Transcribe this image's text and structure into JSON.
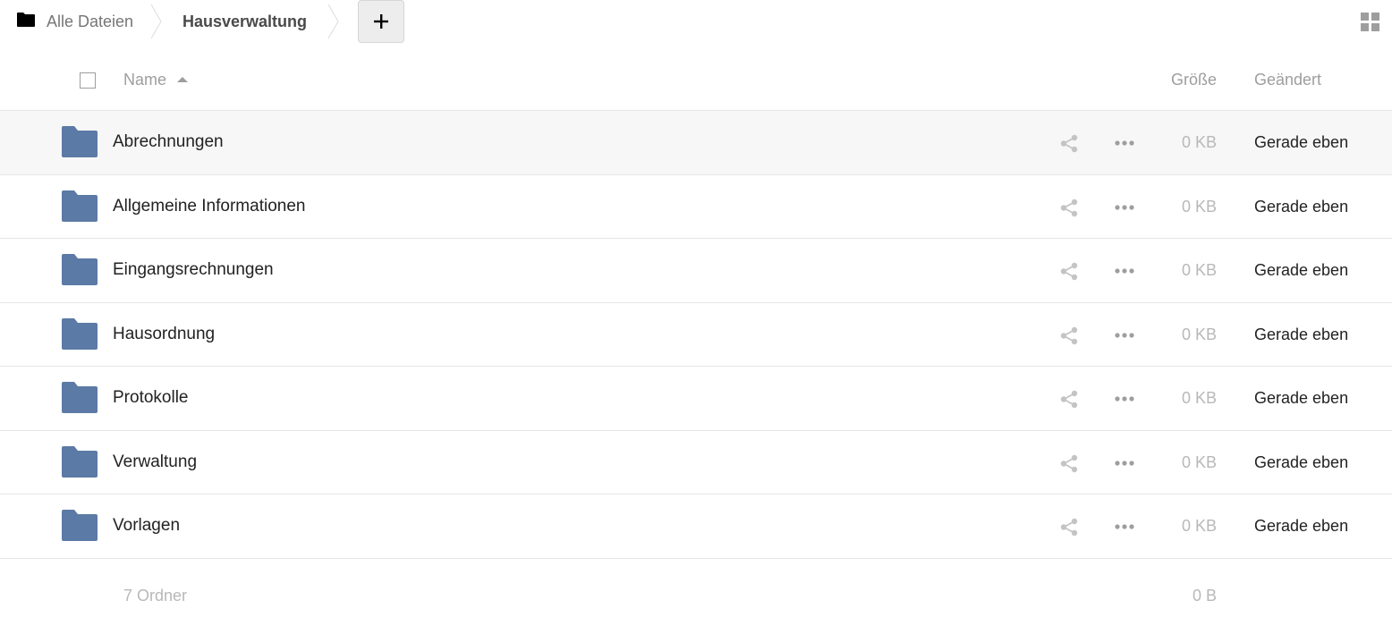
{
  "breadcrumb": {
    "home_label": "Alle Dateien",
    "current_label": "Hausverwaltung",
    "add_label": "+"
  },
  "header": {
    "name_label": "Name",
    "size_label": "Größe",
    "modified_label": "Geändert"
  },
  "colors": {
    "folder": "#5b7aa6",
    "muted_text": "#9e9e9e",
    "row_hover": "#f7f7f7",
    "border": "#e6e6e6"
  },
  "files": [
    {
      "name": "Abrechnungen",
      "size": "0 KB",
      "modified": "Gerade eben",
      "icon": "folder-icon"
    },
    {
      "name": "Allgemeine Informationen",
      "size": "0 KB",
      "modified": "Gerade eben",
      "icon": "folder-icon"
    },
    {
      "name": "Eingangsrechnungen",
      "size": "0 KB",
      "modified": "Gerade eben",
      "icon": "folder-icon"
    },
    {
      "name": "Hausordnung",
      "size": "0 KB",
      "modified": "Gerade eben",
      "icon": "folder-icon"
    },
    {
      "name": "Protokolle",
      "size": "0 KB",
      "modified": "Gerade eben",
      "icon": "folder-icon"
    },
    {
      "name": "Verwaltung",
      "size": "0 KB",
      "modified": "Gerade eben",
      "icon": "folder-icon"
    },
    {
      "name": "Vorlagen",
      "size": "0 KB",
      "modified": "Gerade eben",
      "icon": "folder-icon"
    }
  ],
  "summary": {
    "count_label": "7 Ordner",
    "total_size": "0 B"
  }
}
